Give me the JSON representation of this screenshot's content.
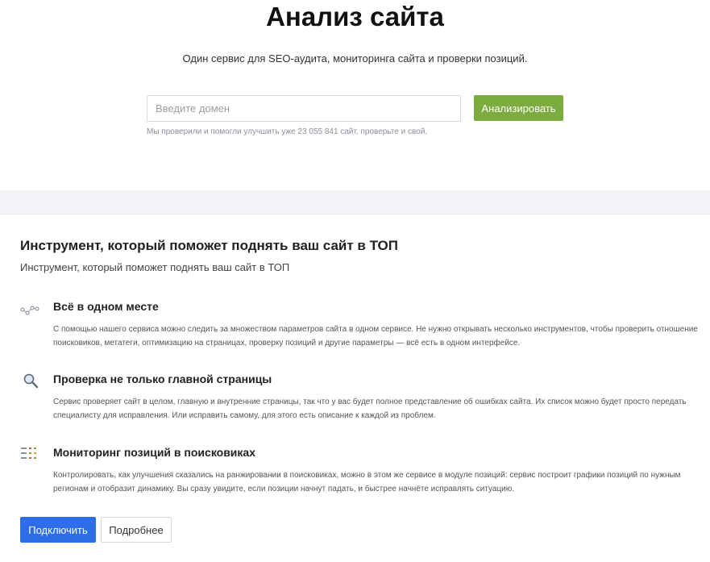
{
  "hero": {
    "title": "Анализ сайта",
    "subtitle": "Один сервис для SEO-аудита, мониторинга сайта и проверки позиций.",
    "domain_placeholder": "Введите домен",
    "domain_value": "",
    "analyze_label": "Анализировать",
    "note": "Мы проверили и помогли улучшить уже 23 055 841 сайт, проверьте и свой."
  },
  "section": {
    "title": "Инструмент, который поможет поднять ваш сайт в ТОП",
    "subtitle": "Инструмент, который поможет поднять ваш сайт в ТОП"
  },
  "features": [
    {
      "icon": "chart-nodes-icon",
      "title": "Всё в одном месте",
      "text": "С помощью нашего сервиса можно следить за множеством параметров сайта в одном сервисе. Не нужно открывать несколько инструментов, чтобы проверить отношение поисковиков, метатеги, оптимизацию на страницах, проверку позиций и другие параметры — всё есть в одном интерфейсе."
    },
    {
      "icon": "magnifier-icon",
      "title": "Проверка не только главной страницы",
      "text": "Сервис проверяет сайт в целом, главную и внутренние страницы, так что у вас будет полное представление об ошибках сайта. Их список можно будет просто передать специалисту для исправления. Или исправить самому, для этого есть описание к каждой из проблем."
    },
    {
      "icon": "positions-list-icon",
      "title": "Мониторинг позиций в поисковиках",
      "text": "Контролировать, как улучшения сказались на ранжировании в поисковиках, можно в этом же сервисе в модуле позиций: сервис построит графики позиций по нужным регионам и отобразит динамику. Вы сразу увидите, если позиции начнут падать, и быстрее начнёте исправлять ситуацию."
    }
  ],
  "actions": {
    "connect_label": "Подключить",
    "more_label": "Подробнее"
  },
  "colors": {
    "analyze_green": "#7cab3f",
    "connect_blue": "#2d6de8",
    "band_gray": "#f2f3f6"
  }
}
